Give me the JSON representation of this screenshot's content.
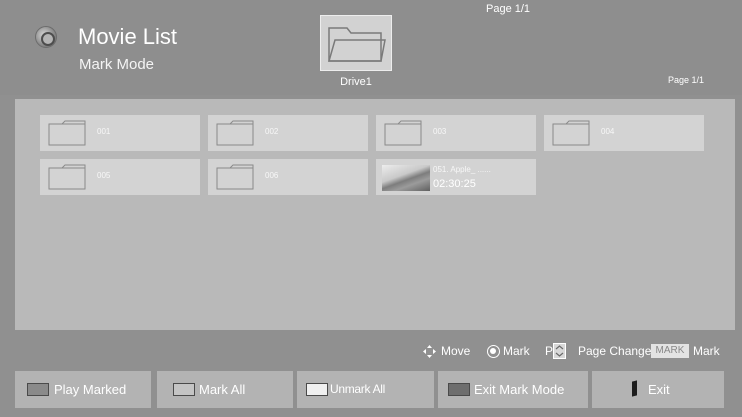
{
  "header": {
    "title": "Movie List",
    "subtitle": "Mark Mode",
    "drive_label": "Drive1",
    "page_top": "Page 1/1",
    "page_right": "Page 1/1"
  },
  "grid": {
    "folders": [
      {
        "name": "001"
      },
      {
        "name": "002"
      },
      {
        "name": "003"
      },
      {
        "name": "004"
      },
      {
        "name": "005"
      },
      {
        "name": "006"
      }
    ],
    "video": {
      "name": "051. Apple_ ......",
      "duration": "02:30:25"
    }
  },
  "hints": {
    "move": "Move",
    "mark": "Mark",
    "p_letter": "P",
    "page_change": "Page Change",
    "mark_key": "MARK",
    "mark_key_label": "Mark"
  },
  "buttons": {
    "play_marked": {
      "label": "Play Marked",
      "color": "#8a8a8a"
    },
    "mark_all": {
      "label": "Mark All",
      "color": "#c4c4c4"
    },
    "unmark_all": {
      "label": "Unmark All",
      "color": "#f0f0f0"
    },
    "exit_mark_mode": {
      "label": "Exit Mark Mode",
      "color": "#6e6e6e"
    },
    "exit": {
      "label": "Exit",
      "icon": "exit-icon"
    }
  }
}
